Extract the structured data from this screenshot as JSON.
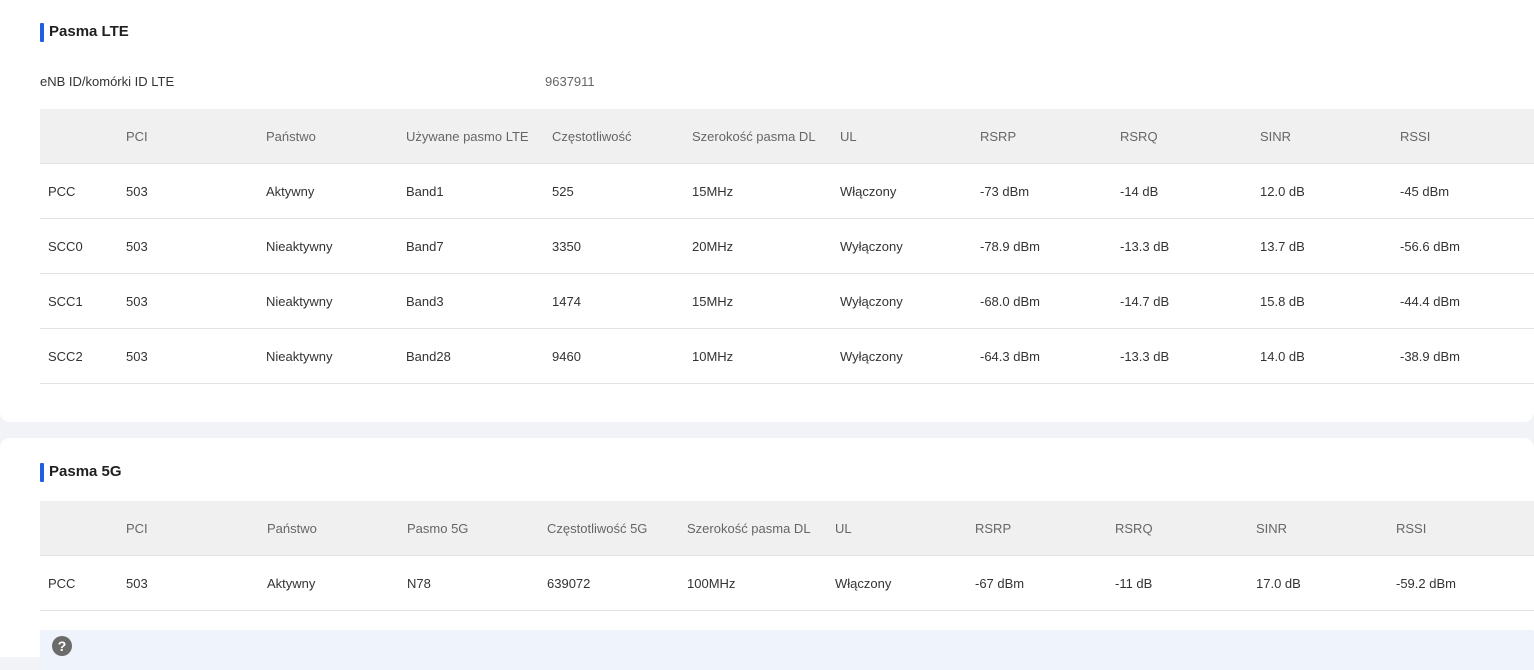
{
  "lte": {
    "title": "Pasma LTE",
    "enb_label": "eNB ID/komórki ID LTE",
    "enb_value": "9637911",
    "headers": [
      "",
      "PCI",
      "Państwo",
      "Używane pasmo LTE",
      "Częstotliwość",
      "Szerokość pasma DL",
      "UL",
      "RSRP",
      "RSRQ",
      "SINR",
      "RSSI"
    ],
    "rows": [
      [
        "PCC",
        "503",
        "Aktywny",
        "Band1",
        "525",
        "15MHz",
        "Włączony",
        "-73 dBm",
        "-14 dB",
        "12.0 dB",
        "-45 dBm"
      ],
      [
        "SCC0",
        "503",
        "Nieaktywny",
        "Band7",
        "3350",
        "20MHz",
        "Wyłączony",
        "-78.9 dBm",
        "-13.3 dB",
        "13.7 dB",
        "-56.6 dBm"
      ],
      [
        "SCC1",
        "503",
        "Nieaktywny",
        "Band3",
        "1474",
        "15MHz",
        "Wyłączony",
        "-68.0 dBm",
        "-14.7 dB",
        "15.8 dB",
        "-44.4 dBm"
      ],
      [
        "SCC2",
        "503",
        "Nieaktywny",
        "Band28",
        "9460",
        "10MHz",
        "Wyłączony",
        "-64.3 dBm",
        "-13.3 dB",
        "14.0 dB",
        "-38.9 dBm"
      ]
    ]
  },
  "nr": {
    "title": "Pasma 5G",
    "headers": [
      "",
      "PCI",
      "Państwo",
      "Pasmo 5G",
      "Częstotliwość 5G",
      "Szerokość pasma DL",
      "UL",
      "RSRP",
      "RSRQ",
      "SINR",
      "RSSI"
    ],
    "rows": [
      [
        "PCC",
        "503",
        "Aktywny",
        "N78",
        "639072",
        "100MHz",
        "Włączony",
        "-67 dBm",
        "-11 dB",
        "17.0 dB",
        "-59.2 dBm"
      ]
    ]
  },
  "help": {
    "icon": "question-icon",
    "glyph": "?"
  },
  "colors": {
    "accent": "#1f5fe0",
    "header_bg": "#f0f0f0",
    "help_bg": "#eef3fc"
  }
}
